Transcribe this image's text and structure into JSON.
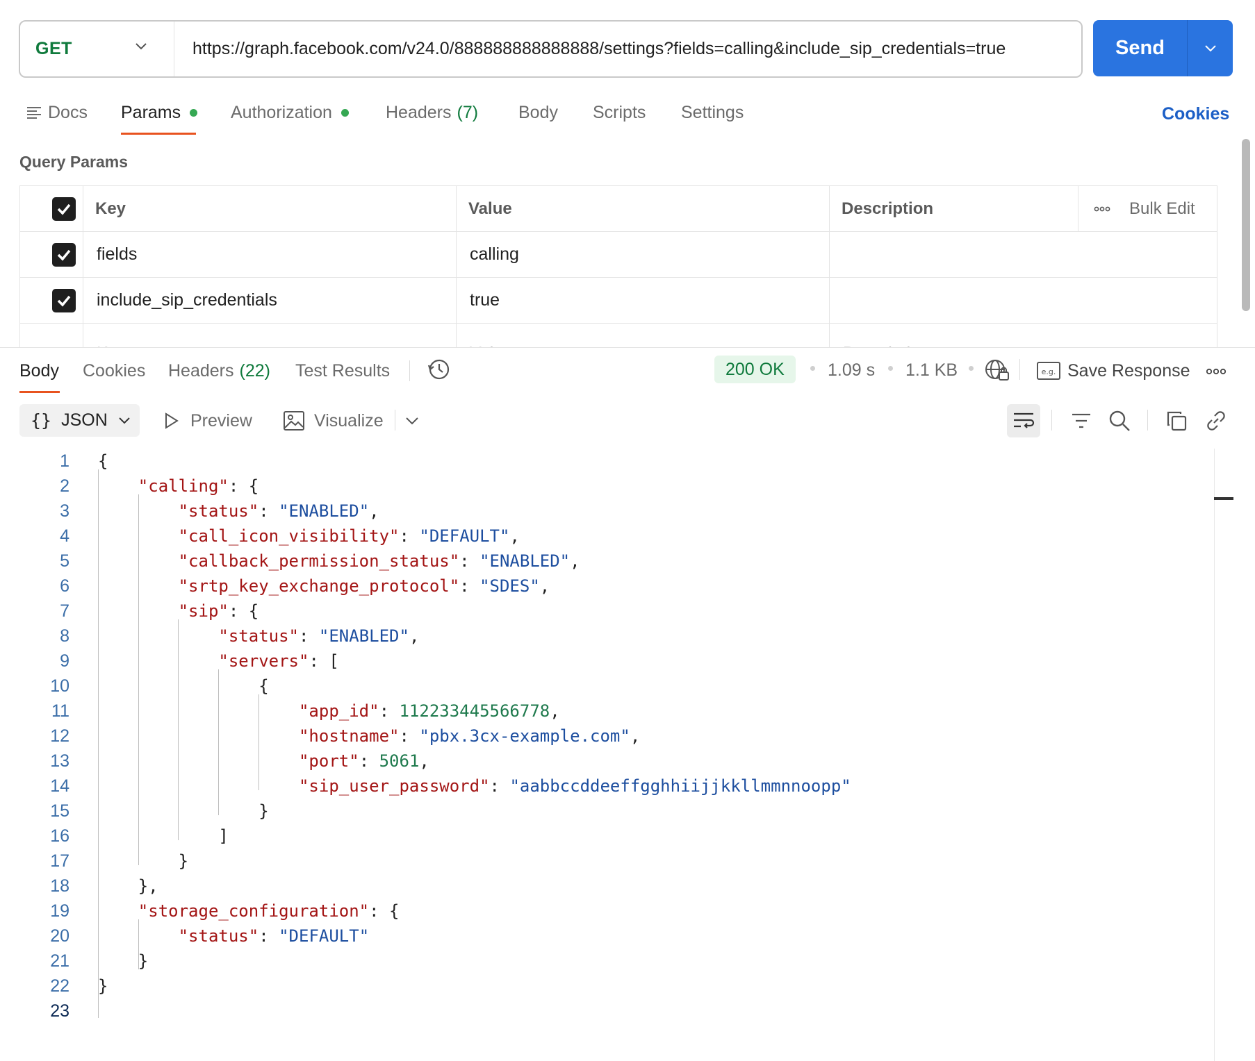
{
  "request": {
    "method": "GET",
    "url": "https://graph.facebook.com/v24.0/888888888888888/settings?fields=calling&include_sip_credentials=true",
    "send_label": "Send"
  },
  "req_tabs": {
    "docs": "Docs",
    "params": "Params",
    "authorization": "Authorization",
    "headers": "Headers",
    "headers_count": "(7)",
    "body": "Body",
    "scripts": "Scripts",
    "settings": "Settings",
    "cookies": "Cookies"
  },
  "query_params": {
    "title": "Query Params",
    "columns": {
      "key": "Key",
      "value": "Value",
      "description": "Description",
      "bulk_edit": "Bulk Edit"
    },
    "rows": [
      {
        "key": "fields",
        "value": "calling",
        "description": "",
        "checked": true
      },
      {
        "key": "include_sip_credentials",
        "value": "true",
        "description": "",
        "checked": true
      }
    ],
    "placeholders": {
      "key": "Key",
      "value": "Value",
      "description": "Description"
    }
  },
  "response": {
    "tabs": {
      "body": "Body",
      "cookies": "Cookies",
      "headers": "Headers",
      "headers_count": "(22)",
      "test_results": "Test Results"
    },
    "status": "200 OK",
    "time": "1.09 s",
    "size": "1.1 KB",
    "save_response": "Save Response",
    "format": "JSON",
    "preview": "Preview",
    "visualize": "Visualize"
  },
  "code_lines": [
    "1",
    "2",
    "3",
    "4",
    "5",
    "6",
    "7",
    "8",
    "9",
    "10",
    "11",
    "12",
    "13",
    "14",
    "15",
    "16",
    "17",
    "18",
    "19",
    "20",
    "21",
    "22",
    "23"
  ],
  "json_body": {
    "calling_key": "\"calling\"",
    "status_key": "\"status\"",
    "status_val": "\"ENABLED\"",
    "icon_key": "\"call_icon_visibility\"",
    "icon_val": "\"DEFAULT\"",
    "callback_key": "\"callback_permission_status\"",
    "callback_val": "\"ENABLED\"",
    "srtp_key": "\"srtp_key_exchange_protocol\"",
    "srtp_val": "\"SDES\"",
    "sip_key": "\"sip\"",
    "sip_status_key": "\"status\"",
    "sip_status_val": "\"ENABLED\"",
    "servers_key": "\"servers\"",
    "app_id_key": "\"app_id\"",
    "app_id_val": "112233445566778",
    "hostname_key": "\"hostname\"",
    "hostname_val": "\"pbx.3cx-example.com\"",
    "port_key": "\"port\"",
    "port_val": "5061",
    "pwd_key": "\"sip_user_password\"",
    "pwd_val": "\"aabbccddeeffgghhiijjkkllmmnnoopp\"",
    "storage_key": "\"storage_configuration\"",
    "storage_status_key": "\"status\"",
    "storage_status_val": "\"DEFAULT\""
  },
  "colors": {
    "accent": "#e8531f",
    "send": "#2a74e0",
    "ok": "#0f7a3c",
    "json_key": "#a31515",
    "json_string": "#1d4e9f",
    "json_number": "#1f7a4d"
  }
}
